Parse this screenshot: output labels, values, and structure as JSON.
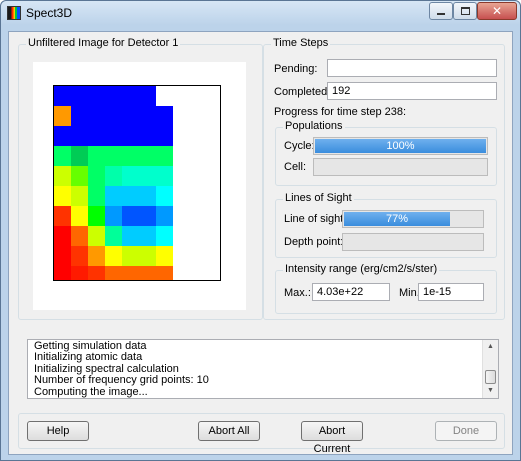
{
  "window": {
    "title": "Spect3D",
    "controls": {
      "minimize_icon": "minimize-icon",
      "maximize_icon": "maximize-icon",
      "close_glyph": "✕"
    }
  },
  "image_panel": {
    "label": "Unfiltered Image for Detector 1",
    "heatmap_colors": [
      [
        "#0000ff",
        "#0000ff",
        "#0000ff",
        "#0000ff",
        "#0000ff",
        "#0000ff",
        "#ffffff",
        "#ffffff",
        "#ffffff",
        "#ffffff"
      ],
      [
        "#ff9900",
        "#0000ff",
        "#0000ff",
        "#0000ff",
        "#0000ff",
        "#0000ff",
        "#0000ff",
        "#ffffff",
        "#ffffff",
        "#ffffff"
      ],
      [
        "#0000ff",
        "#0000ff",
        "#0000ff",
        "#0000ff",
        "#0000ff",
        "#0000ff",
        "#0000ff",
        "#ffffff",
        "#ffffff",
        "#ffffff"
      ],
      [
        "#00ff66",
        "#00cc55",
        "#00ff66",
        "#00ff66",
        "#00ff66",
        "#00ff66",
        "#00ff66",
        "#ffffff",
        "#ffffff",
        "#ffffff"
      ],
      [
        "#ccff00",
        "#66ff00",
        "#00ff66",
        "#00ffaa",
        "#00ffcc",
        "#00ffcc",
        "#00ffcc",
        "#ffffff",
        "#ffffff",
        "#ffffff"
      ],
      [
        "#ffff00",
        "#ccff00",
        "#00ff66",
        "#00ccff",
        "#00ccff",
        "#00ccff",
        "#00ffff",
        "#ffffff",
        "#ffffff",
        "#ffffff"
      ],
      [
        "#ff3300",
        "#ffff00",
        "#00ff00",
        "#0099ff",
        "#0055ff",
        "#0055ff",
        "#0099ff",
        "#ffffff",
        "#ffffff",
        "#ffffff"
      ],
      [
        "#ff0000",
        "#ff6600",
        "#ccff00",
        "#00ff99",
        "#00ccff",
        "#00ccff",
        "#00ffff",
        "#ffffff",
        "#ffffff",
        "#ffffff"
      ],
      [
        "#ff0000",
        "#ff3300",
        "#ff9900",
        "#ffff00",
        "#ccff00",
        "#ccff00",
        "#ffff00",
        "#ffffff",
        "#ffffff",
        "#ffffff"
      ],
      [
        "#ff0000",
        "#ff1a00",
        "#ff3300",
        "#ff6600",
        "#ff6600",
        "#ff6600",
        "#ff6600",
        "#ffffff",
        "#ffffff",
        "#ffffff"
      ]
    ]
  },
  "time_steps": {
    "label": "Time Steps",
    "pending_label": "Pending:",
    "pending_value": "",
    "completed_label": "Completed:",
    "completed_value": "192",
    "progress_caption": "Progress for time step 238:",
    "populations": {
      "label": "Populations",
      "cycle_label": "Cycle:",
      "cycle_percent": 100,
      "cycle_text": "100%",
      "cell_label": "Cell:",
      "cell_percent": 0
    },
    "lines_of_sight": {
      "label": "Lines of Sight",
      "los_label": "Line of sight:",
      "los_percent": 77,
      "los_text": "77%",
      "depth_label": "Depth point:",
      "depth_percent": 0
    },
    "intensity": {
      "label": "Intensity range (erg/cm2/s/ster)",
      "max_label": "Max.:",
      "max_value": "4.03e+22",
      "min_label": "Min.:",
      "min_value": "1e-15"
    }
  },
  "log": {
    "lines": [
      "Getting simulation data",
      "Initializing atomic data",
      "Initializing spectral calculation",
      "Number of frequency grid points: 10",
      "Computing the image..."
    ],
    "scroll_up_icon": "▲",
    "scroll_down_icon": "▼"
  },
  "buttons": {
    "help": "Help",
    "abort_all": "Abort All",
    "abort_current": "Abort Current",
    "done": "Done"
  },
  "colors": {
    "progress_fill": "#3a8ddd",
    "window_frame": "#bcd3ea"
  }
}
